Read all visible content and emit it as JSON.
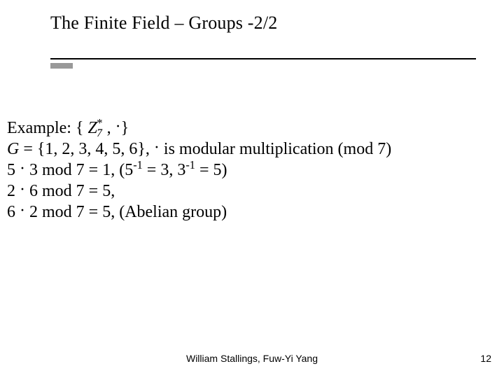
{
  "title": {
    "text_pre": "The Finite Field ",
    "dash": "–",
    "text_post": " Groups -2/2"
  },
  "body": {
    "line1": {
      "pre": "Example: { ",
      "Z": "Z",
      "sub": "7",
      "sup": "*",
      "mid": " , ",
      "dot": "·",
      "post": "}"
    },
    "line2": {
      "G": "G",
      "pre": " = {1, 2, 3, 4, 5, 6}, ",
      "dot": "·",
      "post": " is modular multiplication (mod 7)"
    },
    "line3": {
      "pre": " 5 ",
      "dot": "·",
      "mid": " 3 mod 7 = 1, (5",
      "inv1": "-1",
      "mid2": " = 3, 3",
      "inv2": "-1",
      "post": " = 5)"
    },
    "line4": {
      "pre": " 2 ",
      "dot": "·",
      "post": " 6 mod 7 = 5,"
    },
    "line5": {
      "pre": " 6 ",
      "dot": "·",
      "post": " 2 mod 7 = 5, (Abelian group)"
    }
  },
  "footer": {
    "credits": "William Stallings, Fuw-Yi Yang",
    "page": "12"
  }
}
